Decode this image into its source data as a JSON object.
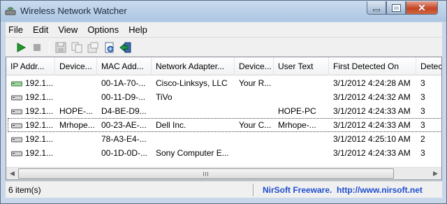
{
  "window": {
    "title": "Wireless Network Watcher"
  },
  "menu": [
    "File",
    "Edit",
    "View",
    "Options",
    "Help"
  ],
  "toolbar": {
    "buttons": [
      "start-icon",
      "stop-icon",
      "save-icon",
      "copy-icon",
      "properties-icon",
      "html-report-icon",
      "exit-icon"
    ]
  },
  "table": {
    "columns": [
      "IP Addr...",
      "Device...",
      "MAC Add...",
      "Network Adapter...",
      "Device...",
      "User Text",
      "First Detected On",
      "Detec"
    ],
    "rows": [
      [
        "192.1...",
        "",
        "00-1A-70-...",
        "Cisco-Linksys, LLC",
        "Your R...",
        "",
        "3/1/2012 4:24:28 AM",
        "3"
      ],
      [
        "192.1...",
        "",
        "00-11-D9-...",
        "TiVo",
        "",
        "",
        "3/1/2012 4:24:32 AM",
        "3"
      ],
      [
        "192.1...",
        "HOPE-...",
        "D4-BE-D9...",
        "",
        "",
        "HOPE-PC",
        "3/1/2012 4:24:33 AM",
        "3"
      ],
      [
        "192.1...",
        "Mrhope...",
        "00-23-AE-...",
        "Dell Inc.",
        "Your C...",
        "Mrhope-...",
        "3/1/2012 4:24:33 AM",
        "3"
      ],
      [
        "192.1...",
        "",
        "78-A3-E4-...",
        "",
        "",
        "",
        "3/1/2012 4:25:10 AM",
        "2"
      ],
      [
        "192.1...",
        "",
        "00-1D-0D-...",
        "Sony Computer E...",
        "",
        "",
        "3/1/2012 4:24:33 AM",
        "3"
      ]
    ],
    "selected_row": 3
  },
  "status": {
    "items": "6 item(s)",
    "credit": "NirSoft Freeware.  http://www.nirsoft.net"
  },
  "colors": {
    "accent_link": "#1f4fd0",
    "titlebar": "#b9cfe7",
    "close": "#c44424"
  }
}
